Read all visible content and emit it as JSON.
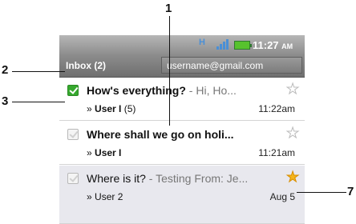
{
  "status_bar": {
    "network": "H",
    "time": "11:27",
    "ampm": "AM"
  },
  "title_bar": {
    "folder": "Inbox (2)",
    "account": "username@gmail.com"
  },
  "conversations": [
    {
      "subject": "How's everything?",
      "snippet": " - Hi, Ho...",
      "from": "User I",
      "count": "(5)",
      "date": "11:22am",
      "checked": true,
      "starred": false
    },
    {
      "subject": "Where shall we go on holi...",
      "snippet": "",
      "from": "User I",
      "count": "",
      "date": "11:21am",
      "checked": false,
      "starred": false
    },
    {
      "subject": "Where is it?",
      "snippet": " - Testing From: Je...",
      "from": "User 2",
      "count": "",
      "date": "Aug 5",
      "checked": false,
      "starred": true
    }
  ],
  "from_prefix": "»",
  "callouts": {
    "c1": "1",
    "c2": "2",
    "c3": "3",
    "c7": "7"
  },
  "colors": {
    "check_green": "#36a82e",
    "star_gold": "#f5b51b",
    "accent_blue": "#4a8fd6"
  }
}
